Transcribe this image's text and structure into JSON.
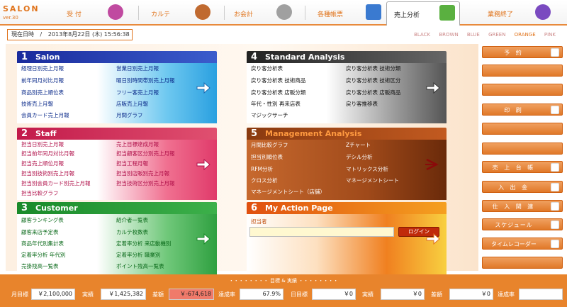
{
  "app": {
    "logo": "SALON",
    "version": "ver.30"
  },
  "tabs": [
    {
      "label": "受 付",
      "icon": "reception-icon"
    },
    {
      "label": "カルテ",
      "icon": "chart-icon"
    },
    {
      "label": "お会計",
      "icon": "register-icon"
    },
    {
      "label": "各種帳票",
      "icon": "forms-icon"
    },
    {
      "label": "売上分析",
      "icon": "sales-analysis-icon"
    },
    {
      "label": "業務終了",
      "icon": "moon-icon"
    }
  ],
  "date": {
    "label": "現在日時",
    "value": "2013年8月22日 (木)  15:56:38"
  },
  "themes": [
    "BLACK",
    "BROWN",
    "BLUE",
    "GREEN",
    "ORANGE",
    "PINK"
  ],
  "selected_theme": "ORANGE",
  "panels": {
    "salon": {
      "num": "1",
      "title": "Salon",
      "left": [
        "経理日別売上月報",
        "前年同月対比月報",
        "商品別売上順位表",
        "技術売上月報",
        "会員カード売上月報"
      ],
      "right": [
        "営業日別売上月報",
        "曜日別時間帯別売上月報",
        "フリー客売上月報",
        "店販売上月報",
        "月間グラフ"
      ]
    },
    "staff": {
      "num": "2",
      "title": "Staff",
      "left": [
        "担当日別売上月報",
        "担当前年同月対比月報",
        "担当売上順位月報",
        "担当別技術別売上月報",
        "担当別会員カード別売上月報",
        "担当比較グラフ"
      ],
      "right": [
        "売上目標達成月報",
        "担当顧客区分別売上月報",
        "担当工程月報",
        "担当別店販別売上月報",
        "担当技術区分別売上月報"
      ]
    },
    "customer": {
      "num": "3",
      "title": "Customer",
      "left": [
        "顧客ランキング表",
        "顧客来店予定表",
        "商品年代別集計表",
        "定着率分析  年代別",
        "売掛残高一覧表"
      ],
      "right": [
        "紹介者一覧表",
        "カルテ枚数表",
        "定着率分析  来店動機別",
        "定着率分析  職業別",
        "ポイント残高一覧表"
      ]
    },
    "standard": {
      "num": "4",
      "title": "Standard Analysis",
      "left": [
        "戻り客分析表",
        "戻り客分析表  技術商品",
        "戻り客分析表  店販分類",
        "年代・性別  再来店表",
        "マジックサーチ"
      ],
      "right": [
        "戻り客分析表  技術分類",
        "戻り客分析表  技術区分",
        "戻り客分析表  店販商品",
        "戻り客推移表"
      ]
    },
    "management": {
      "num": "5",
      "title": "Management Analysis",
      "left": [
        "月間比較グラフ",
        "担当別順位表",
        "RFM分析",
        "クロス分析",
        "マネージメントシート（店舗）"
      ],
      "right": [
        "Zチャート",
        "デシル分析",
        "マトリックス分析",
        "マネージメントシート"
      ]
    },
    "action": {
      "num": "6",
      "title": "My Action Page",
      "staff_label": "担当者",
      "staff_value": "",
      "login": "ログイン"
    }
  },
  "right_buttons": [
    {
      "label": "予 約",
      "icon": "reservation-icon"
    },
    {
      "label": "",
      "icon": ""
    },
    {
      "label": "",
      "icon": ""
    },
    {
      "label": "印 刷",
      "icon": "printer-icon"
    },
    {
      "label": "",
      "icon": ""
    },
    {
      "label": "",
      "icon": ""
    },
    {
      "label": "売 上 台 帳",
      "icon": "ledger-icon"
    },
    {
      "label": "入 出 金",
      "icon": "cash-icon"
    },
    {
      "label": "仕 入 関 連",
      "icon": "purchase-icon"
    },
    {
      "label": "スケジュール",
      "icon": "schedule-icon"
    },
    {
      "label": "タイムレコーダー",
      "icon": "time-recorder-icon"
    },
    {
      "label": "",
      "icon": ""
    }
  ],
  "bottom": {
    "title": "・・・・・・・・ 目標 & 実績 ・・・・・・・・",
    "month_target_label": "月目標",
    "month_target": "￥2,100,000",
    "month_actual_label": "実績",
    "month_actual": "￥1,425,382",
    "month_diff_label": "差額",
    "month_diff": "￥-674,618",
    "month_rate_label": "達成率",
    "month_rate": "67.9%",
    "day_target_label": "日目標",
    "day_target": "￥0",
    "day_actual_label": "実績",
    "day_actual": "￥0",
    "day_diff_label": "差額",
    "day_diff": "￥0",
    "day_rate_label": "達成率",
    "day_rate": ""
  }
}
